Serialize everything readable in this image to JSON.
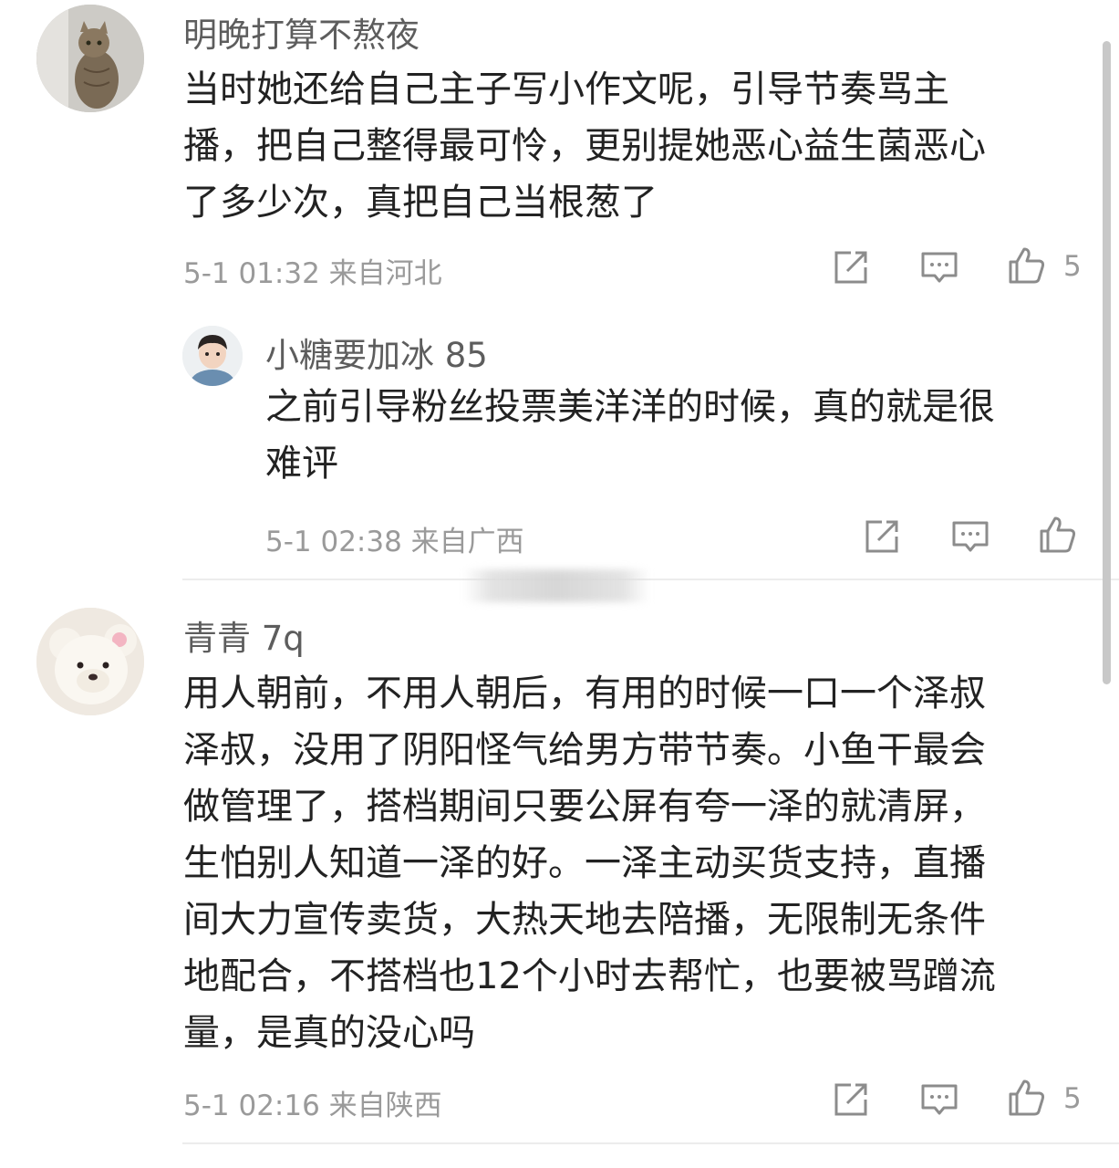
{
  "comments": [
    {
      "username": "明晚打算不熬夜",
      "text": "当时她还给自己主子写小作文呢，引导节奏骂主\n播，把自己整得最可怜，更别提她恶心益生菌恶心\n了多少次，真把自己当根葱了",
      "meta": "5-1 01:32  来自河北",
      "likes": "5",
      "avatar_icon": "cat-avatar-icon",
      "reply": {
        "username": "小糖要加冰 85",
        "text": "之前引导粉丝投票美洋洋的时候，真的就是很\n难评",
        "meta": "5-1 02:38  来自广西",
        "avatar_icon": "boy-avatar-icon"
      }
    },
    {
      "username": "青青 7q",
      "text": "用人朝前，不用人朝后，有用的时候一口一个泽叔\n泽叔，没用了阴阳怪气给男方带节奏。小鱼干最会\n做管理了，搭档期间只要公屏有夸一泽的就清屏，\n生怕别人知道一泽的好。一泽主动买货支持，直播\n间大力宣传卖货，大热天地去陪播，无限制无条件\n地配合，不搭档也12个小时去帮忙，也要被骂蹭流\n量，是真的没心吗",
      "meta": "5-1 02:16  来自陕西",
      "likes": "5",
      "avatar_icon": "teddy-bear-avatar-icon"
    }
  ],
  "icons": {
    "share": "share-icon",
    "comment": "comment-icon",
    "like": "thumbs-up-icon"
  },
  "colors": {
    "text": "#222222",
    "username": "#5d5d5d",
    "meta": "#9a9a9a",
    "icon": "#8c8c8c"
  }
}
